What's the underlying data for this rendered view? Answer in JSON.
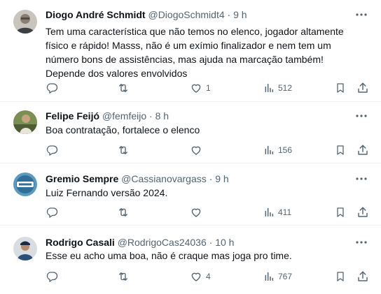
{
  "tweets": [
    {
      "name": "Diogo André Schmidt",
      "handle": "@DiogoSchmidt4",
      "separator": "·",
      "time": "9 h",
      "text": "Tem uma característica que não temos no elenco, jogador altamente físico e rápido! Masss, não é um exímio finalizador e nem tem um número bons de assistências, mas ajuda na marcação também! Depende dos valores envolvidos",
      "replies": "",
      "retweets": "",
      "likes": "1",
      "views": "512"
    },
    {
      "name": "Felipe Feijó",
      "handle": "@femfeijo",
      "separator": "·",
      "time": "8 h",
      "text": "Boa contratação, fortalece o elenco",
      "replies": "",
      "retweets": "",
      "likes": "",
      "views": "156"
    },
    {
      "name": "Gremio Sempre",
      "handle": "@Cassianovargass",
      "separator": "·",
      "time": "9 h",
      "text": "Luiz Fernando versão 2024.",
      "replies": "",
      "retweets": "",
      "likes": "",
      "views": "411"
    },
    {
      "name": "Rodrigo Casali",
      "handle": "@RodrigoCas24036",
      "separator": "·",
      "time": "10 h",
      "text": "Esse eu acho uma boa, não é craque mas joga pro time.",
      "replies": "",
      "retweets": "",
      "likes": "4",
      "views": "767"
    }
  ],
  "icons": {
    "reply": "reply-icon",
    "retweet": "retweet-icon",
    "like": "heart-icon",
    "views": "views-icon",
    "bookmark": "bookmark-icon",
    "share": "share-icon",
    "more": "more-icon"
  },
  "colors": {
    "text": "#0f1419",
    "secondary": "#536471",
    "divider": "#eff3f4"
  }
}
